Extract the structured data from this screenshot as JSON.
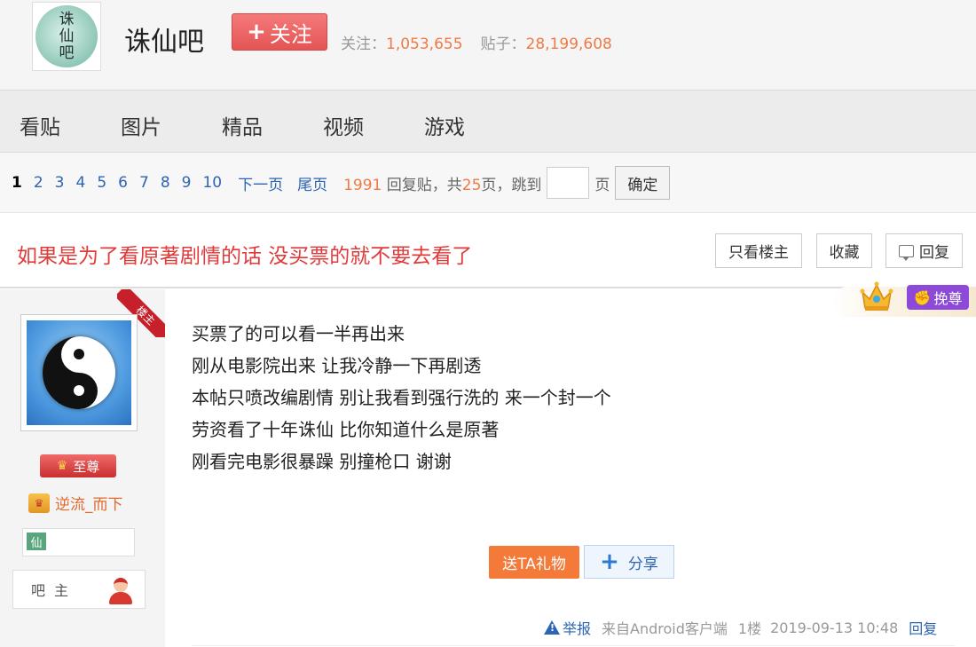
{
  "header": {
    "logo_chars": [
      "诛",
      "仙",
      "吧"
    ],
    "bar_name": "诛仙吧",
    "follow_label": "关注",
    "follow_plus": "+",
    "stats_follow_label": "关注：",
    "stats_follow_value": "1,053,655",
    "stats_posts_label": "贴子：",
    "stats_posts_value": "28,199,608"
  },
  "nav": {
    "items": [
      "看贴",
      "图片",
      "精品",
      "视频",
      "游戏"
    ]
  },
  "pager": {
    "pages": [
      "1",
      "2",
      "3",
      "4",
      "5",
      "6",
      "7",
      "8",
      "9",
      "10"
    ],
    "current": "1",
    "next_label": "下一页",
    "last_label": "尾页",
    "reply_count": "1991",
    "reply_label": "回复贴，共",
    "page_total": "25",
    "page_unit": "页，跳到",
    "page_suffix": "页",
    "confirm_label": "确定"
  },
  "thread": {
    "title": "如果是为了看原著剧情的话 没买票的就不要去看了",
    "only_author_label": "只看楼主",
    "favorite_label": "收藏",
    "reply_label": "回复"
  },
  "post": {
    "louzhu_label": "楼主",
    "crown_label": "挽尊",
    "vip_label": "至尊",
    "author_name": "逆流_而下",
    "level_char": "仙",
    "role_label": "吧主",
    "content_lines": [
      "买票了的可以看一半再出来",
      "刚从电影院出来 让我冷静一下再剧透",
      "本帖只喷改编剧情 别让我看到强行洗的 来一个封一个",
      "劳资看了十年诛仙 比你知道什么是原著",
      "刚看完电影很暴躁 别撞枪口 谢谢"
    ],
    "gift_label": "送TA礼物",
    "share_label": "分享",
    "report_label": "举报",
    "source": "来自Android客户端",
    "floor": "1楼",
    "time": "2019-09-13 10:48",
    "reply_label": "回复"
  },
  "colors": {
    "accent_orange": "#f07a45",
    "title_red": "#e13a3a",
    "link_blue": "#2d64b3",
    "follow_red": "#e45454"
  }
}
